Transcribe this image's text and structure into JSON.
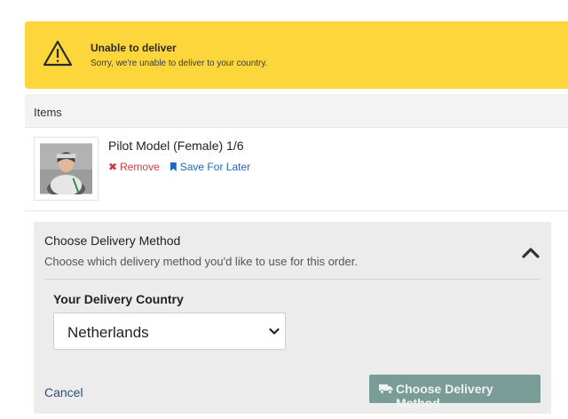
{
  "alert": {
    "title": "Unable to deliver",
    "message": "Sorry, we're unable to deliver to your country.",
    "icon": "warning-icon",
    "color": "#fdd63c"
  },
  "items": {
    "header": "Items",
    "list": [
      {
        "title": "Pilot Model (Female) 1/6",
        "remove_label": "Remove",
        "save_label": "Save For Later"
      }
    ]
  },
  "delivery": {
    "title": "Choose Delivery Method",
    "subtitle": "Choose which delivery method you'd like to use for this order.",
    "country_label": "Your Delivery Country",
    "country_value": "Netherlands",
    "cancel_label": "Cancel",
    "submit_label": "Choose Delivery Method",
    "submit_color": "#7a9c96"
  }
}
